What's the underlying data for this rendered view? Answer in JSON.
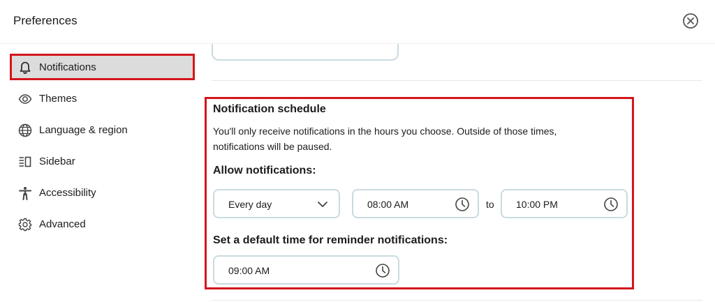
{
  "header": {
    "title": "Preferences",
    "close_icon": "close-circle-icon"
  },
  "sidebar": {
    "items": [
      {
        "label": "Notifications",
        "icon": "bell-icon",
        "active": true
      },
      {
        "label": "Themes",
        "icon": "eye-icon",
        "active": false
      },
      {
        "label": "Language & region",
        "icon": "globe-icon",
        "active": false
      },
      {
        "label": "Sidebar",
        "icon": "sidebar-layout-icon",
        "active": false
      },
      {
        "label": "Accessibility",
        "icon": "accessibility-person-icon",
        "active": false
      },
      {
        "label": "Advanced",
        "icon": "gear-icon",
        "active": false
      }
    ]
  },
  "schedule": {
    "title": "Notification schedule",
    "description": "You'll only receive notifications in the hours you choose. Outside of those times, notifications will be paused.",
    "allow_label": "Allow notifications:",
    "frequency": {
      "value": "Every day",
      "icon": "chevron-down-icon"
    },
    "start_time": {
      "value": "08:00 AM",
      "icon": "clock-icon"
    },
    "to_label": "to",
    "end_time": {
      "value": "10:00 PM",
      "icon": "clock-icon"
    },
    "reminder_label": "Set a default time for reminder notifications:",
    "reminder_time": {
      "value": "09:00 AM",
      "icon": "clock-icon"
    }
  },
  "colors": {
    "highlight_border": "#d3161c",
    "active_bg": "#dcdcdc",
    "field_border": "#c9dbe0",
    "text": "#1d1c1d"
  }
}
